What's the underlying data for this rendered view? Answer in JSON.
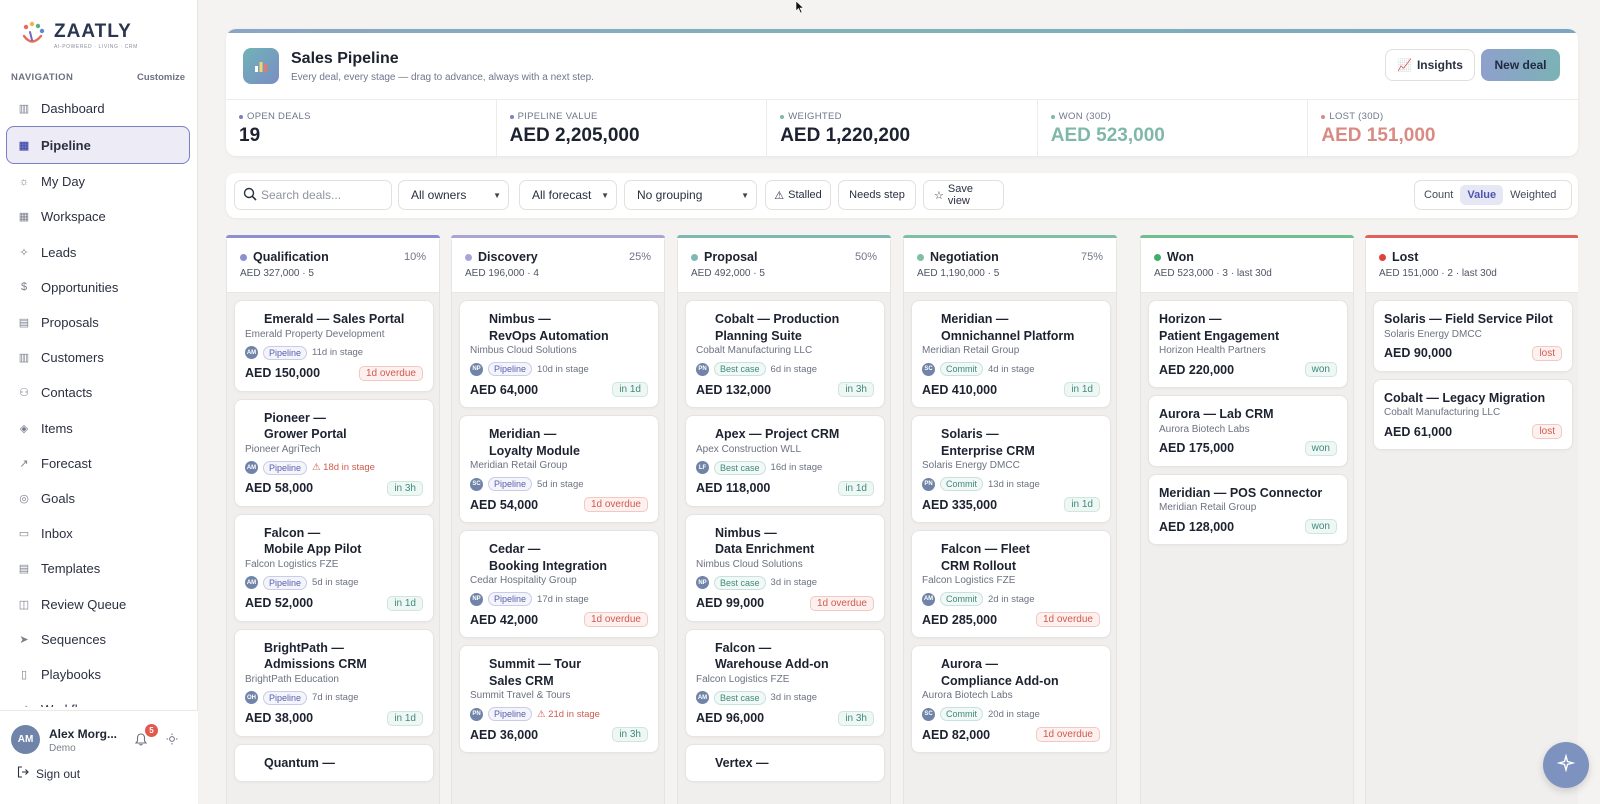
{
  "brand": {
    "name": "ZAATLY",
    "tagline": "AI-POWERED · LIVING · CRM"
  },
  "nav": {
    "heading": "NAVIGATION",
    "customize": "Customize",
    "items": [
      {
        "label": "Dashboard",
        "icon": "bar-chart-icon"
      },
      {
        "label": "Pipeline",
        "icon": "kanban-icon",
        "active": true
      },
      {
        "label": "My Day",
        "icon": "sun-icon"
      },
      {
        "label": "Workspace",
        "icon": "grid-icon"
      },
      {
        "label": "Leads",
        "icon": "sparkle-icon"
      },
      {
        "label": "Opportunities",
        "icon": "dollar-icon"
      },
      {
        "label": "Proposals",
        "icon": "file-icon"
      },
      {
        "label": "Customers",
        "icon": "building-icon"
      },
      {
        "label": "Contacts",
        "icon": "users-icon"
      },
      {
        "label": "Items",
        "icon": "box-icon"
      },
      {
        "label": "Forecast",
        "icon": "trend-icon"
      },
      {
        "label": "Goals",
        "icon": "target-icon"
      },
      {
        "label": "Inbox",
        "icon": "chat-icon"
      },
      {
        "label": "Templates",
        "icon": "template-icon"
      },
      {
        "label": "Review Queue",
        "icon": "inbox-icon"
      },
      {
        "label": "Sequences",
        "icon": "send-icon"
      },
      {
        "label": "Playbooks",
        "icon": "book-icon"
      },
      {
        "label": "Workflows",
        "icon": "flow-icon"
      }
    ]
  },
  "user": {
    "initials": "AM",
    "name": "Alex Morg...",
    "role": "Demo",
    "notifications": "5",
    "signout": "Sign out"
  },
  "header": {
    "title": "Sales Pipeline",
    "subtitle": "Every deal, every stage — drag to advance, always with a next step.",
    "insights_label": "Insights",
    "new_deal_label": "New deal"
  },
  "stats": [
    {
      "label": "OPEN DEALS",
      "value": "19",
      "dot": "#7c7fc4",
      "color": "#1d2230"
    },
    {
      "label": "PIPELINE VALUE",
      "value": "AED 2,205,000",
      "dot": "#7c7fc4",
      "color": "#1d2230"
    },
    {
      "label": "WEIGHTED",
      "value": "AED 1,220,200",
      "dot": "#7fb8a8",
      "color": "#1d2230"
    },
    {
      "label": "WON (30D)",
      "value": "AED 523,000",
      "dot": "#7fb8a8",
      "color": "#7fb8a8"
    },
    {
      "label": "LOST (30D)",
      "value": "AED 151,000",
      "dot": "#d98a82",
      "color": "#d98a82"
    }
  ],
  "filters": {
    "search_placeholder": "Search deals...",
    "owners": "All owners",
    "forecast": "All forecast",
    "grouping": "No grouping",
    "stalled": "Stalled",
    "needs_step": "Needs step",
    "save_view": "Save view",
    "modes": [
      "Count",
      "Value",
      "Weighted"
    ],
    "active_mode": "Value"
  },
  "columns": [
    {
      "name": "Qualification",
      "pct": "10%",
      "summary": "AED 327,000 · 5",
      "bar": "#8c8fd0",
      "dot": "#8c8fd0",
      "cards": [
        {
          "title": "Emerald — Sales Portal",
          "company": "Emerald Property Development",
          "owner": "AM",
          "forecast": "Pipeline",
          "fclass": "",
          "age": "11d in stage",
          "stalled": false,
          "amount": "AED 150,000",
          "tag": "1d overdue",
          "tclass": "over"
        },
        {
          "title": "Pioneer —\nGrower Portal",
          "company": "Pioneer AgriTech",
          "owner": "AM",
          "forecast": "Pipeline",
          "fclass": "",
          "age": "⚠ 18d in stage",
          "stalled": true,
          "amount": "AED 58,000",
          "tag": "in 3h",
          "tclass": "soon"
        },
        {
          "title": "Falcon —\nMobile App Pilot",
          "company": "Falcon Logistics FZE",
          "owner": "AM",
          "forecast": "Pipeline",
          "fclass": "",
          "age": "5d in stage",
          "stalled": false,
          "amount": "AED 52,000",
          "tag": "in 1d",
          "tclass": "soon"
        },
        {
          "title": "BrightPath —\nAdmissions CRM",
          "company": "BrightPath Education",
          "owner": "OH",
          "forecast": "Pipeline",
          "fclass": "",
          "age": "7d in stage",
          "stalled": false,
          "amount": "AED 38,000",
          "tag": "in 1d",
          "tclass": "soon"
        },
        {
          "title": "Quantum —\n",
          "company": "",
          "owner": "",
          "forecast": "",
          "fclass": "",
          "age": "",
          "stalled": false,
          "amount": "",
          "tag": "",
          "tclass": ""
        }
      ]
    },
    {
      "name": "Discovery",
      "pct": "25%",
      "summary": "AED 196,000 · 4",
      "bar": "#a8a5d6",
      "dot": "#a8a5d6",
      "cards": [
        {
          "title": "Nimbus —\nRevOps Automation",
          "company": "Nimbus Cloud Solutions",
          "owner": "NP",
          "forecast": "Pipeline",
          "fclass": "",
          "age": "10d in stage",
          "stalled": false,
          "amount": "AED 64,000",
          "tag": "in 1d",
          "tclass": "soon"
        },
        {
          "title": "Meridian —\nLoyalty Module",
          "company": "Meridian Retail Group",
          "owner": "SC",
          "forecast": "Pipeline",
          "fclass": "",
          "age": "5d in stage",
          "stalled": false,
          "amount": "AED 54,000",
          "tag": "1d overdue",
          "tclass": "over"
        },
        {
          "title": "Cedar —\nBooking Integration",
          "company": "Cedar Hospitality Group",
          "owner": "NP",
          "forecast": "Pipeline",
          "fclass": "",
          "age": "17d in stage",
          "stalled": false,
          "amount": "AED 42,000",
          "tag": "1d overdue",
          "tclass": "over"
        },
        {
          "title": "Summit — Tour\nSales CRM",
          "company": "Summit Travel & Tours",
          "owner": "PN",
          "forecast": "Pipeline",
          "fclass": "",
          "age": "⚠ 21d in stage",
          "stalled": true,
          "amount": "AED 36,000",
          "tag": "in 3h",
          "tclass": "soon"
        }
      ]
    },
    {
      "name": "Proposal",
      "pct": "50%",
      "summary": "AED 492,000 · 5",
      "bar": "#7fb8b2",
      "dot": "#7fb8b2",
      "cards": [
        {
          "title": "Cobalt — Production\nPlanning Suite",
          "company": "Cobalt Manufacturing LLC",
          "owner": "PN",
          "forecast": "Best case",
          "fclass": "best",
          "age": "6d in stage",
          "stalled": false,
          "amount": "AED 132,000",
          "tag": "in 3h",
          "tclass": "soon"
        },
        {
          "title": "Apex — Project CRM",
          "company": "Apex Construction WLL",
          "owner": "LF",
          "forecast": "Best case",
          "fclass": "best",
          "age": "16d in stage",
          "stalled": false,
          "amount": "AED 118,000",
          "tag": "in 1d",
          "tclass": "soon"
        },
        {
          "title": "Nimbus —\nData Enrichment",
          "company": "Nimbus Cloud Solutions",
          "owner": "NP",
          "forecast": "Best case",
          "fclass": "best",
          "age": "3d in stage",
          "stalled": false,
          "amount": "AED 99,000",
          "tag": "1d overdue",
          "tclass": "over"
        },
        {
          "title": "Falcon —\nWarehouse Add-on",
          "company": "Falcon Logistics FZE",
          "owner": "AM",
          "forecast": "Best case",
          "fclass": "best",
          "age": "3d in stage",
          "stalled": false,
          "amount": "AED 96,000",
          "tag": "in 3h",
          "tclass": "soon"
        },
        {
          "title": "Vertex —\n",
          "company": "",
          "owner": "",
          "forecast": "",
          "fclass": "",
          "age": "",
          "stalled": false,
          "amount": "",
          "tag": "",
          "tclass": ""
        }
      ]
    },
    {
      "name": "Negotiation",
      "pct": "75%",
      "summary": "AED 1,190,000 · 5",
      "bar": "#7fc0a4",
      "dot": "#7fc0a4",
      "cards": [
        {
          "title": "Meridian —\nOmnichannel Platform",
          "company": "Meridian Retail Group",
          "owner": "SC",
          "forecast": "Commit",
          "fclass": "commit",
          "age": "4d in stage",
          "stalled": false,
          "amount": "AED 410,000",
          "tag": "in 1d",
          "tclass": "soon"
        },
        {
          "title": "Solaris —\nEnterprise CRM",
          "company": "Solaris Energy DMCC",
          "owner": "PN",
          "forecast": "Commit",
          "fclass": "commit",
          "age": "13d in stage",
          "stalled": false,
          "amount": "AED 335,000",
          "tag": "in 1d",
          "tclass": "soon"
        },
        {
          "title": "Falcon — Fleet\nCRM Rollout",
          "company": "Falcon Logistics FZE",
          "owner": "AM",
          "forecast": "Commit",
          "fclass": "commit",
          "age": "2d in stage",
          "stalled": false,
          "amount": "AED 285,000",
          "tag": "1d overdue",
          "tclass": "over"
        },
        {
          "title": "Aurora —\nCompliance Add-on",
          "company": "Aurora Biotech Labs",
          "owner": "SC",
          "forecast": "Commit",
          "fclass": "commit",
          "age": "20d in stage",
          "stalled": false,
          "amount": "AED 82,000",
          "tag": "1d overdue",
          "tclass": "over"
        }
      ]
    },
    {
      "name": "Won",
      "pct": "",
      "summary": "AED 523,000 · 3 · last 30d",
      "bar": "#6fc08e",
      "dot": "#3fae6a",
      "cards": [
        {
          "title": "Horizon —\nPatient Engagement",
          "company": "Horizon Health Partners",
          "owner": "",
          "forecast": "",
          "fclass": "",
          "age": "",
          "stalled": false,
          "amount": "AED 220,000",
          "tag": "won",
          "tclass": "won",
          "flat": true
        },
        {
          "title": "Aurora — Lab CRM",
          "company": "Aurora Biotech Labs",
          "owner": "",
          "forecast": "",
          "fclass": "",
          "age": "",
          "stalled": false,
          "amount": "AED 175,000",
          "tag": "won",
          "tclass": "won",
          "flat": true
        },
        {
          "title": "Meridian — POS Connector",
          "company": "Meridian Retail Group",
          "owner": "",
          "forecast": "",
          "fclass": "",
          "age": "",
          "stalled": false,
          "amount": "AED 128,000",
          "tag": "won",
          "tclass": "won",
          "flat": true
        }
      ]
    },
    {
      "name": "Lost",
      "pct": "",
      "summary": "AED 151,000 · 2 · last 30d",
      "bar": "#e2605a",
      "dot": "#e2403a",
      "cards": [
        {
          "title": "Solaris — Field Service Pilot",
          "company": "Solaris Energy DMCC",
          "owner": "",
          "forecast": "",
          "fclass": "",
          "age": "",
          "stalled": false,
          "amount": "AED 90,000",
          "tag": "lost",
          "tclass": "lost",
          "flat": true
        },
        {
          "title": "Cobalt — Legacy Migration",
          "company": "Cobalt Manufacturing LLC",
          "owner": "",
          "forecast": "",
          "fclass": "",
          "age": "",
          "stalled": false,
          "amount": "AED 61,000",
          "tag": "lost",
          "tclass": "lost",
          "flat": true
        }
      ]
    }
  ]
}
